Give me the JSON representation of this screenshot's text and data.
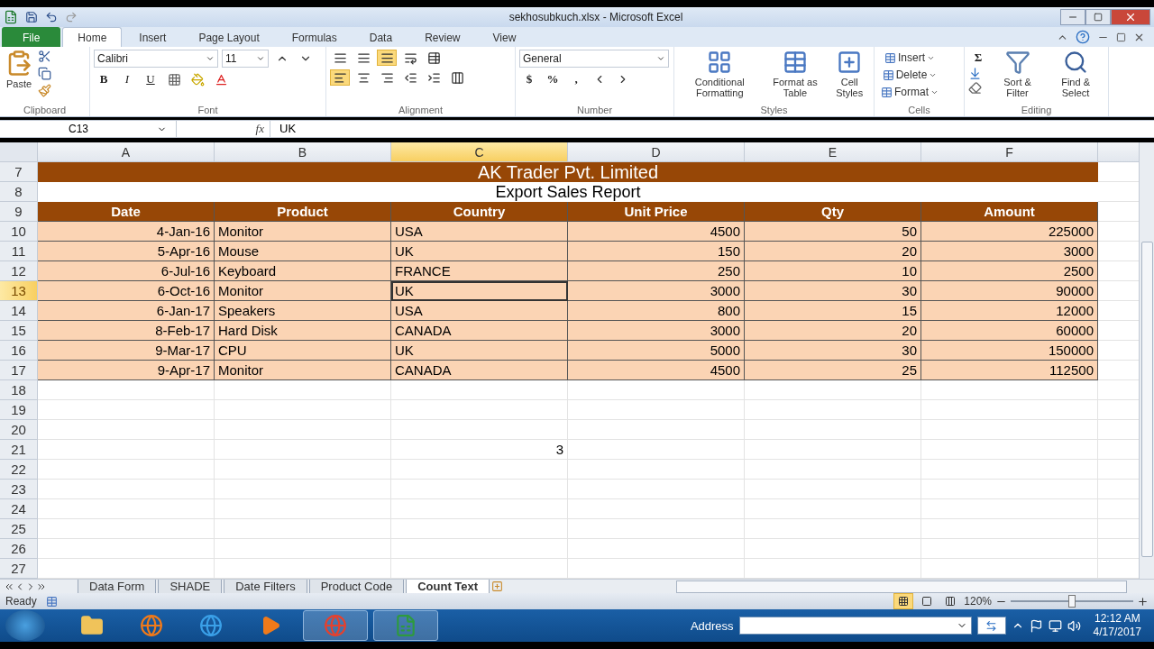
{
  "window": {
    "title": "sekhosubkuch.xlsx - Microsoft Excel"
  },
  "menu_tabs": [
    {
      "label": "File",
      "kind": "file",
      "selected": false
    },
    {
      "label": "Home",
      "kind": "tab",
      "selected": true
    },
    {
      "label": "Insert",
      "kind": "tab",
      "selected": false
    },
    {
      "label": "Page Layout",
      "kind": "tab",
      "selected": false
    },
    {
      "label": "Formulas",
      "kind": "tab",
      "selected": false
    },
    {
      "label": "Data",
      "kind": "tab",
      "selected": false
    },
    {
      "label": "Review",
      "kind": "tab",
      "selected": false
    },
    {
      "label": "View",
      "kind": "tab",
      "selected": false
    }
  ],
  "ribbon": {
    "clipboard": {
      "label": "Clipboard",
      "paste": "Paste"
    },
    "font": {
      "label": "Font",
      "font_name": "Calibri",
      "font_size": "11",
      "bold": "B",
      "italic": "I",
      "underline": "U"
    },
    "alignment": {
      "label": "Alignment"
    },
    "number": {
      "label": "Number",
      "format": "General",
      "currency": "$",
      "percent": "%",
      "comma": ","
    },
    "styles": {
      "label": "Styles",
      "buttons": [
        "Conditional Formatting",
        "Format as Table",
        "Cell Styles"
      ]
    },
    "cells": {
      "label": "Cells",
      "buttons": [
        "Insert",
        "Delete",
        "Format"
      ]
    },
    "editing": {
      "label": "Editing",
      "sum": "Σ",
      "buttons": [
        "Sort & Filter",
        "Find & Select"
      ]
    }
  },
  "formula_bar": {
    "name_box": "C13",
    "fx": "fx",
    "value": "UK"
  },
  "columns": [
    {
      "label": "A",
      "selected": false
    },
    {
      "label": "B",
      "selected": false
    },
    {
      "label": "C",
      "selected": true
    },
    {
      "label": "D",
      "selected": false
    },
    {
      "label": "E",
      "selected": false
    },
    {
      "label": "F",
      "selected": false
    }
  ],
  "rows": [
    {
      "number": "7",
      "kind": "title",
      "selected": false,
      "text": "AK Trader Pvt. Limited"
    },
    {
      "number": "8",
      "kind": "subtitle",
      "selected": false,
      "text": "Export Sales Report"
    },
    {
      "number": "9",
      "kind": "header",
      "selected": false,
      "cells": [
        "Date",
        "Product",
        "Country",
        "Unit Price",
        "Qty",
        "Amount"
      ]
    },
    {
      "number": "10",
      "kind": "data",
      "selected": false,
      "cells": [
        "4-Jan-16",
        "Monitor",
        "USA",
        "4500",
        "50",
        "225000"
      ]
    },
    {
      "number": "11",
      "kind": "data",
      "selected": false,
      "cells": [
        "5-Apr-16",
        "Mouse",
        "UK",
        "150",
        "20",
        "3000"
      ]
    },
    {
      "number": "12",
      "kind": "data",
      "selected": false,
      "cells": [
        "6-Jul-16",
        "Keyboard",
        "FRANCE",
        "250",
        "10",
        "2500"
      ]
    },
    {
      "number": "13",
      "kind": "data",
      "selected": true,
      "cells": [
        "6-Oct-16",
        "Monitor",
        "UK",
        "3000",
        "30",
        "90000"
      ]
    },
    {
      "number": "14",
      "kind": "data",
      "selected": false,
      "cells": [
        "6-Jan-17",
        "Speakers",
        "USA",
        "800",
        "15",
        "12000"
      ]
    },
    {
      "number": "15",
      "kind": "data",
      "selected": false,
      "cells": [
        "8-Feb-17",
        "Hard Disk",
        "CANADA",
        "3000",
        "20",
        "60000"
      ]
    },
    {
      "number": "16",
      "kind": "data",
      "selected": false,
      "cells": [
        "9-Mar-17",
        "CPU",
        "UK",
        "5000",
        "30",
        "150000"
      ]
    },
    {
      "number": "17",
      "kind": "data",
      "selected": false,
      "cells": [
        "9-Apr-17",
        "Monitor",
        "CANADA",
        "4500",
        "25",
        "112500"
      ]
    },
    {
      "number": "18",
      "kind": "empty",
      "selected": false
    },
    {
      "number": "19",
      "kind": "empty",
      "selected": false
    },
    {
      "number": "20",
      "kind": "empty",
      "selected": false
    },
    {
      "number": "21",
      "kind": "plain",
      "selected": false,
      "cells": [
        null,
        null,
        "3",
        null,
        null,
        null
      ]
    },
    {
      "number": "22",
      "kind": "empty",
      "selected": false
    },
    {
      "number": "23",
      "kind": "empty",
      "selected": false
    },
    {
      "number": "24",
      "kind": "empty",
      "selected": false
    },
    {
      "number": "25",
      "kind": "empty",
      "selected": false
    },
    {
      "number": "26",
      "kind": "empty",
      "selected": false
    },
    {
      "number": "27",
      "kind": "empty",
      "selected": false
    }
  ],
  "sheet_tabs": [
    {
      "label": "Data Form",
      "selected": false
    },
    {
      "label": "SHADE",
      "selected": false
    },
    {
      "label": "Date Filters",
      "selected": false
    },
    {
      "label": "Product Code",
      "selected": false
    },
    {
      "label": "Count Text",
      "selected": true
    }
  ],
  "status_bar": {
    "status": "Ready",
    "zoom": "120%",
    "zoom_level": {
      "level": 0.5
    }
  },
  "taskbar": {
    "address_label": "Address",
    "time": "12:12 AM",
    "date": "4/17/2017"
  }
}
